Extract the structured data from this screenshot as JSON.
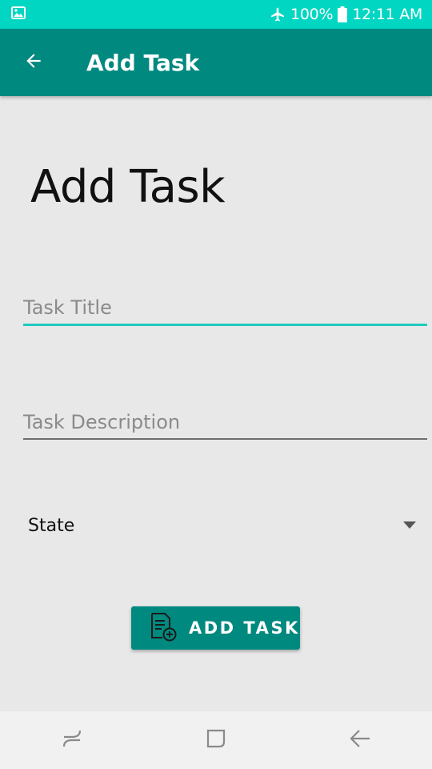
{
  "status_bar": {
    "battery_text": "100%",
    "time": "12:11 AM",
    "icons": [
      "image-notification-icon",
      "airplane-mode-icon",
      "battery-icon"
    ]
  },
  "app_bar": {
    "title": "Add Task",
    "back_icon": "arrow-back-icon"
  },
  "main": {
    "heading": "Add Task",
    "task_title": {
      "value": "",
      "placeholder": "Task Title"
    },
    "task_description": {
      "value": "",
      "placeholder": "Task Description"
    },
    "state_spinner": {
      "selected": "State",
      "icon": "dropdown-arrow-icon"
    },
    "add_button": {
      "label": "ADD TASK",
      "icon": "note-add-icon"
    }
  },
  "nav_bar": {
    "icons": [
      "recent-apps-icon",
      "home-icon",
      "back-icon"
    ]
  },
  "colors": {
    "status_bar": "#00d6c2",
    "app_bar": "#00897f",
    "accent": "#1fcbbd",
    "background": "#e8e8e8",
    "nav_bar": "#f1f1f1"
  }
}
